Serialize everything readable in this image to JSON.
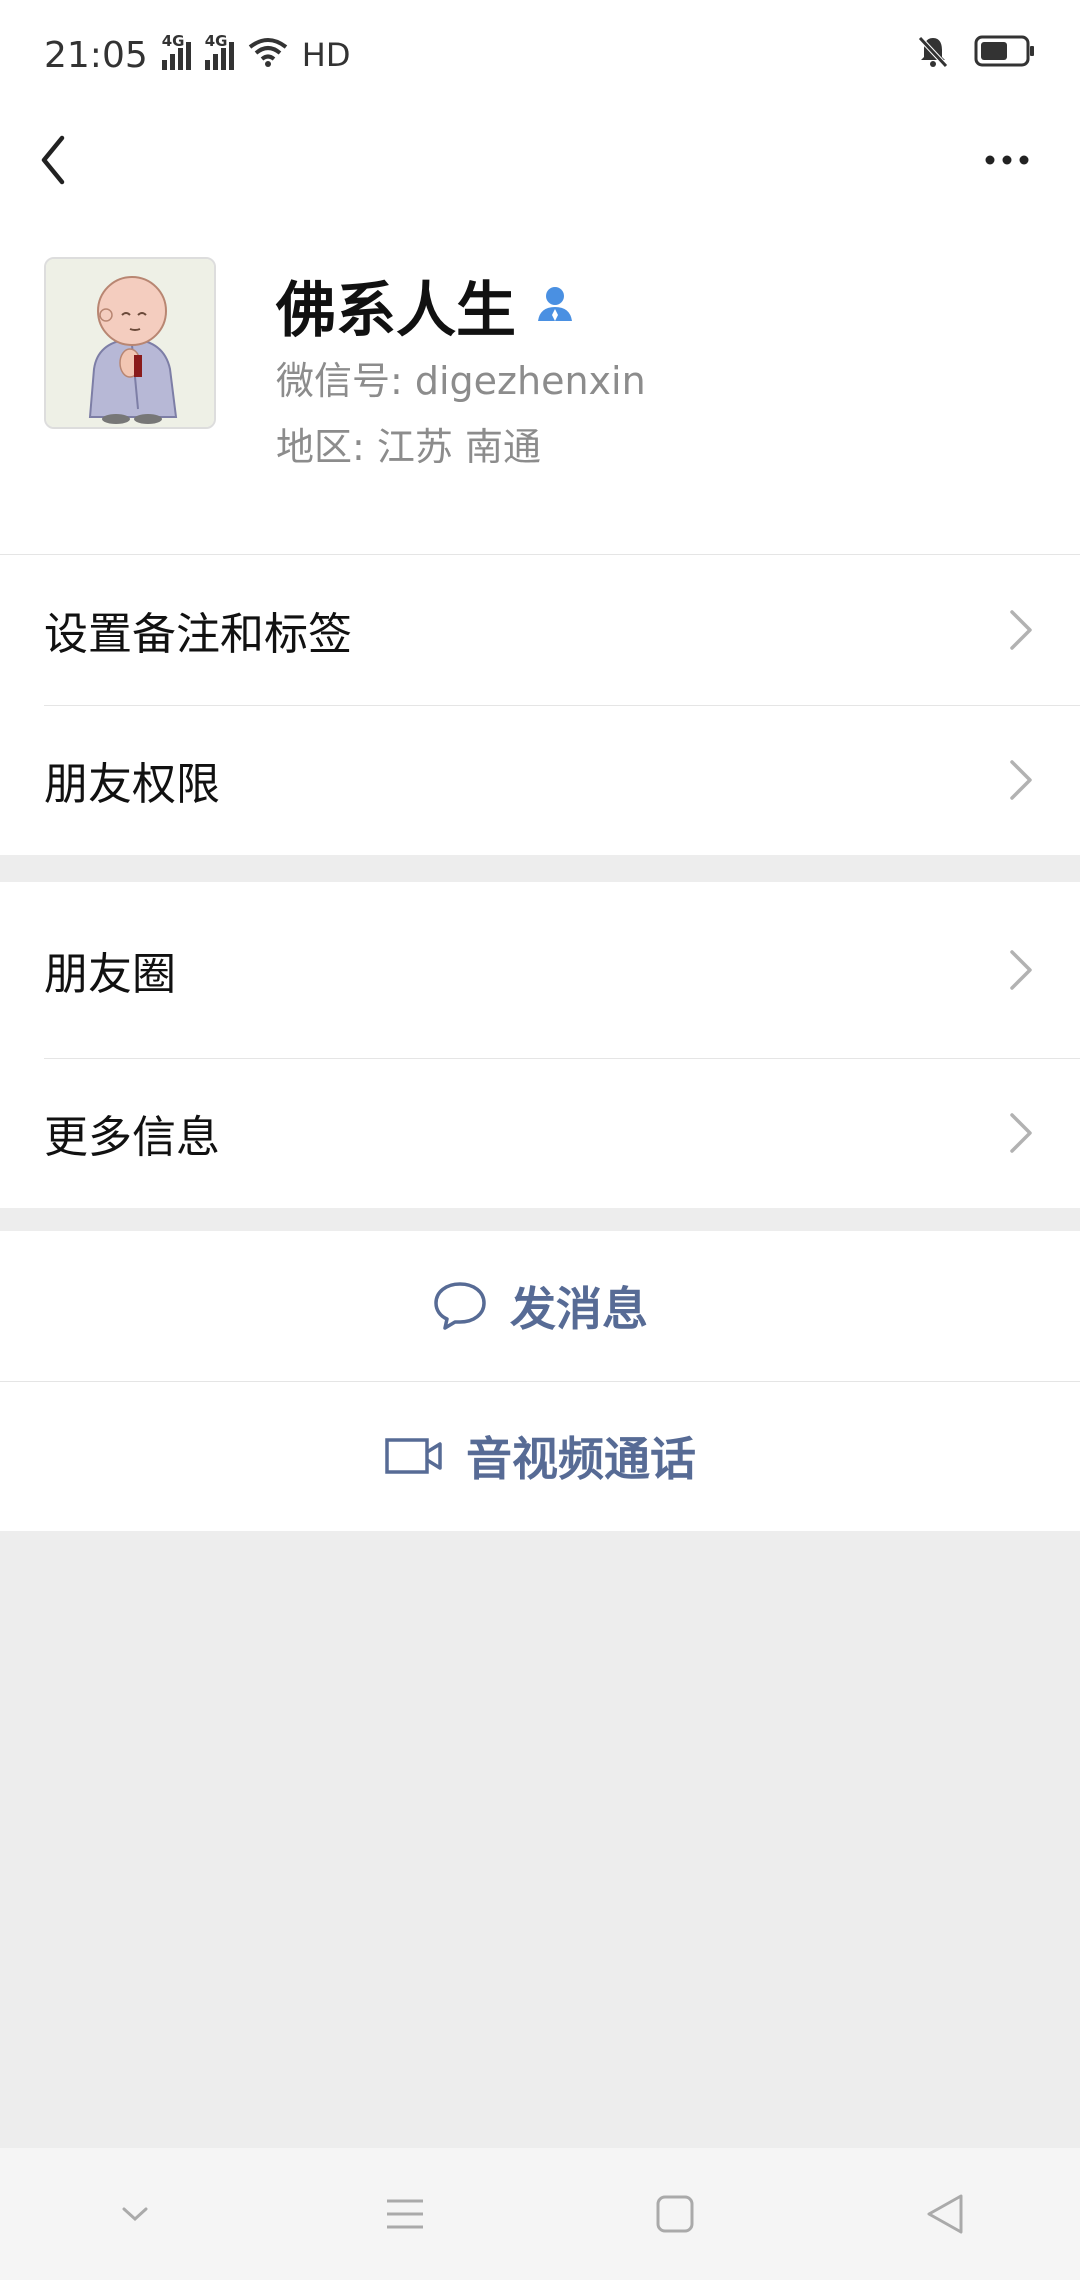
{
  "status_bar": {
    "time": "21:05",
    "sim1": "4G",
    "sim2": "4G",
    "hd": "HD",
    "icons": [
      "signal-icon",
      "signal-icon",
      "wifi-icon",
      "hd-icon",
      "mute-icon",
      "battery-icon"
    ]
  },
  "header": {
    "back_icon": "chevron-left-icon",
    "more_icon": "ellipsis-icon"
  },
  "profile": {
    "nickname": "佛系人生",
    "wechat_id": "微信号: digezhenxin",
    "region": "地区: 江苏 南通",
    "badge_icon": "person-icon"
  },
  "menu_group_1": [
    {
      "label": "设置备注和标签"
    },
    {
      "label": "朋友权限"
    }
  ],
  "menu_group_2": [
    {
      "label": "朋友圈"
    },
    {
      "label": "更多信息"
    }
  ],
  "actions": {
    "message": "发消息",
    "video_call": "音视频通话"
  },
  "colors": {
    "accent": "#576b95",
    "background": "#ededed",
    "badge": "#4a90e2"
  },
  "nav_icons": [
    "chevron-down-icon",
    "menu-icon",
    "home-square-icon",
    "back-triangle-icon"
  ]
}
